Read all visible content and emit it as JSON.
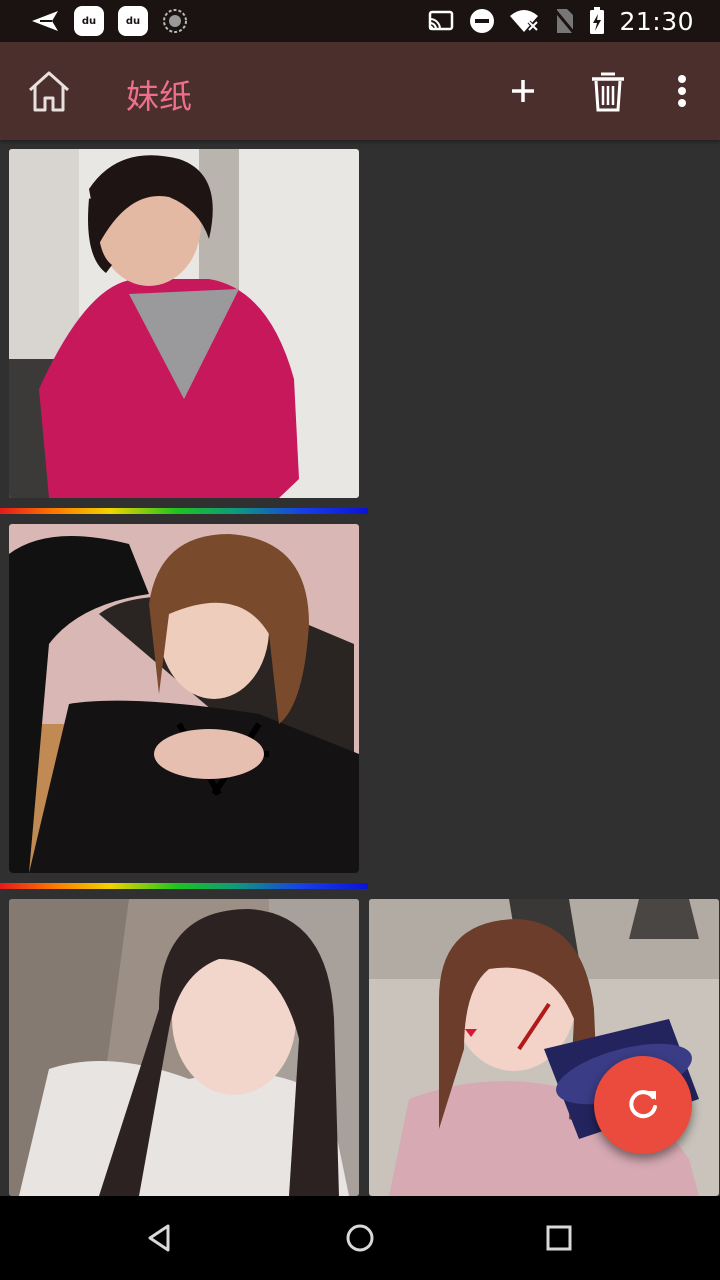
{
  "status_bar": {
    "time": "21:30",
    "left_icons": [
      "send-icon",
      "du-app-icon",
      "du-app-icon",
      "sync-icon"
    ],
    "du_label": "du",
    "right_icons": [
      "cast-icon",
      "do-not-disturb-icon",
      "wifi-off-icon",
      "no-sim-icon",
      "battery-charging-icon"
    ]
  },
  "app_bar": {
    "title": "妹纸",
    "background_color": "#4b2f2d",
    "title_color": "#ee6f8c"
  },
  "gallery": {
    "background_color": "#303030",
    "items": [
      {
        "description_icon": "photo-thumbnail-icon"
      },
      {
        "description_icon": "photo-thumbnail-icon"
      },
      {
        "description_icon": "photo-thumbnail-icon"
      },
      {
        "description_icon": "photo-thumbnail-icon"
      }
    ]
  },
  "fab": {
    "icon": "refresh-icon",
    "color": "#ea4b3c"
  },
  "nav_bar": {
    "buttons": [
      "back-icon",
      "home-circle-icon",
      "recents-icon"
    ]
  }
}
